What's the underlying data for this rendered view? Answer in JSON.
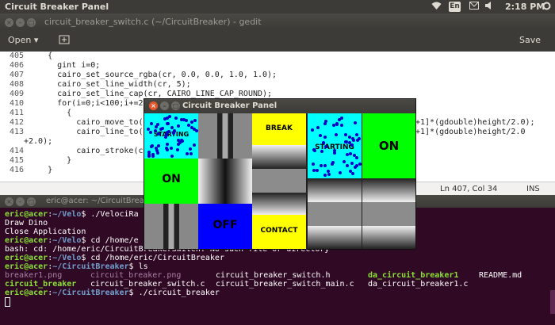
{
  "topbar": {
    "title": "Circuit Breaker Panel",
    "keyboard": "En",
    "time": "2:18 PM"
  },
  "gedit": {
    "title": "circuit_breaker_switch.c (~/CircuitBreaker) - gedit",
    "open_label": "Open",
    "save_label": "Save",
    "lines": [
      {
        "n": "405",
        "text": "    {"
      },
      {
        "n": "406",
        "text": "      gint i=0;"
      },
      {
        "n": "407",
        "text": "      cairo_set_source_rgba(cr, 0.0, 0.0, 1.0, 1.0);"
      },
      {
        "n": "408",
        "text": "      cairo_set_line_width(cr, 5);"
      },
      {
        "n": "409",
        "text": "      cairo_set_line_cap(cr, CAIRO_LINE_CAP_ROUND);"
      },
      {
        "n": "410",
        "text": "      for(i=0;i<100;i+=2)"
      },
      {
        "n": "411",
        "text": "        {"
      },
      {
        "n": "412",
        "text": "          cairo_move_to(c"
      },
      {
        "n": "413",
        "text": "          cairo_line_to(c"
      },
      {
        "n": "",
        "text": "+2.0);"
      },
      {
        "n": "414",
        "text": "          cairo_stroke(cr"
      },
      {
        "n": "415",
        "text": "        }"
      },
      {
        "n": "416",
        "text": "    }"
      }
    ],
    "line412_tail": "+1]*(gdouble)height/2.0);",
    "line413_tail": "+1]*(gdouble)height/2.0",
    "status_pos": "Ln 407, Col 34",
    "status_mode": "INS"
  },
  "terminal": {
    "title": "eric@acer: ~/CircuitBreaker",
    "user": "eric@acer",
    "lines": [
      {
        "path": "~/Velo",
        "cmd": "$ ./VelociRa"
      },
      {
        "plain": "Draw Dino"
      },
      {
        "plain": "Close Application"
      },
      {
        "path": "~/Velo",
        "cmd": "$ cd /home/e"
      },
      {
        "plain": "bash: cd: /home/eric/CircuitBreakerSwitch: No such file or directory"
      },
      {
        "path": "~/Velo",
        "cmd": "$ cd /home/eric/CircuitBreaker"
      },
      {
        "path": "~/CircuitBreaker",
        "cmd": "$ ls"
      },
      {
        "path": "~/CircuitBreaker",
        "cmd": "$ ./circuit_breaker"
      }
    ],
    "ls": {
      "r1": [
        "breaker1.png",
        "circuit_breaker.png",
        "circuit_breaker_switch.h",
        "da_circuit_breaker1",
        "README.md"
      ],
      "r2": [
        "circuit_breaker",
        "circuit_breaker_switch.c",
        "circuit_breaker_switch_main.c",
        "da_circuit_breaker1.c"
      ]
    }
  },
  "panel": {
    "title": "Circuit Breaker Panel",
    "labels": {
      "starting1": "STARTING",
      "break": "BREAK",
      "starting2": "STARTING",
      "on1": "ON",
      "on2": "ON",
      "off": "OFF",
      "contact": "CONTACT"
    },
    "colors": {
      "cyan": "#00ffff",
      "yellow": "#ffff00",
      "green": "#00ff00",
      "blue": "#0000ff"
    }
  }
}
